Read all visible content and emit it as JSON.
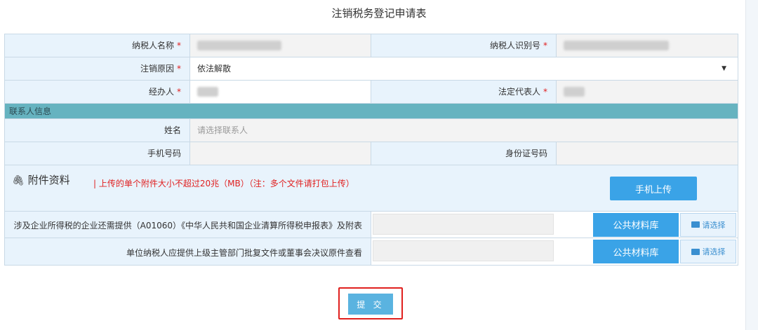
{
  "title": "注销税务登记申请表",
  "form": {
    "taxpayer_name_label": "纳税人名称",
    "taxpayer_id_label": "纳税人识别号",
    "reason_label": "注销原因",
    "reason_value": "依法解散",
    "handler_label": "经办人",
    "legal_rep_label": "法定代表人",
    "required_mark": "*"
  },
  "contact": {
    "section_title": "联系人信息",
    "name_label": "姓名",
    "name_placeholder": "请选择联系人",
    "phone_label": "手机号码",
    "idcard_label": "身份证号码"
  },
  "attachments": {
    "title": "附件资料",
    "note": "| 上传的单个附件大小不超过20兆（MB）（注：多个文件请打包上传）",
    "mobile_upload": "手机上传",
    "materials": [
      {
        "label": "涉及企业所得税的企业还需提供（A01060）《中华人民共和国企业清算所得税申报表》及附表",
        "library": "公共材料库",
        "pick": "请选择"
      },
      {
        "label": "单位纳税人应提供上级主管部门批复文件或董事会决议原件查看",
        "library": "公共材料库",
        "pick": "请选择"
      }
    ]
  },
  "submit_label": "提 交"
}
